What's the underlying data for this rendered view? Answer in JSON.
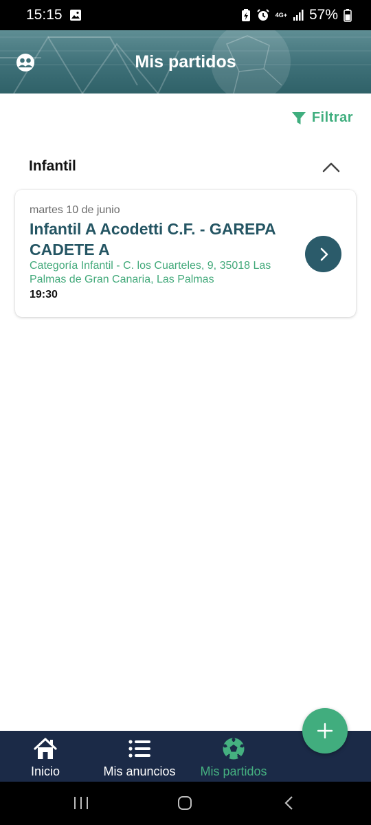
{
  "status_bar": {
    "time": "15:15",
    "network": "4G+",
    "battery": "57%"
  },
  "header": {
    "title": "Mis partidos"
  },
  "filter": {
    "label": "Filtrar"
  },
  "section": {
    "title": "Infantil",
    "matches": [
      {
        "date": "martes 10 de junio",
        "title": "Infantil A Acodetti C.F. - GAREPA CADETE A",
        "location": "Categoría Infantil - C. los Cuarteles, 9, 35018 Las Palmas de Gran Canaria, Las Palmas",
        "time": "19:30"
      }
    ]
  },
  "bottom_nav": {
    "items": [
      {
        "label": "Inicio",
        "icon": "home-icon"
      },
      {
        "label": "Mis anuncios",
        "icon": "list-icon"
      },
      {
        "label": "Mis partidos",
        "icon": "soccer-ball-icon",
        "active": true
      }
    ]
  },
  "colors": {
    "accent_green": "#41ad7e",
    "title_blue": "#245563",
    "nav_background": "#1b2a47",
    "header_teal": "#3e7078"
  }
}
